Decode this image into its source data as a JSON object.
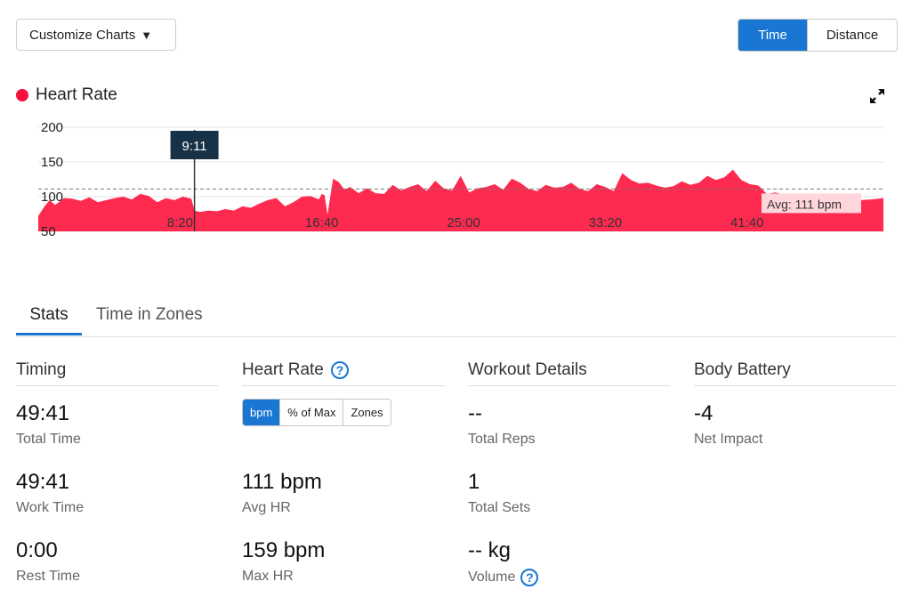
{
  "toolbar": {
    "customize_label": "Customize Charts",
    "caret": "▼",
    "axis_toggle": [
      {
        "label": "Time",
        "active": true
      },
      {
        "label": "Distance",
        "active": false
      }
    ]
  },
  "chart_legend": {
    "label": "Heart Rate",
    "color": "#f5113c"
  },
  "icons": {
    "expand": "expand-icon",
    "help": "help-icon"
  },
  "chart_data": {
    "type": "area",
    "x_unit": "time (seconds)",
    "y_ticks": [
      "200",
      "150",
      "100",
      "50"
    ],
    "ylim": [
      50,
      200
    ],
    "xlim": [
      0,
      2981
    ],
    "x_ticks": [
      {
        "label": "8:20",
        "value": 500
      },
      {
        "label": "16:40",
        "value": 1000
      },
      {
        "label": "25:00",
        "value": 1500
      },
      {
        "label": "33:20",
        "value": 2000
      },
      {
        "label": "41:40",
        "value": 2500
      }
    ],
    "grid": true,
    "color": "#fe2a4f",
    "series": [
      {
        "x": [
          0,
          20,
          40,
          60,
          90,
          120,
          150,
          180,
          210,
          240,
          270,
          300,
          330,
          360,
          390,
          420,
          450,
          480,
          510,
          540,
          551,
          570,
          600,
          630,
          660,
          690,
          720,
          750,
          780,
          810,
          840,
          870,
          900,
          930,
          960,
          990,
          1000,
          1010,
          1020,
          1040,
          1060,
          1080,
          1100,
          1130,
          1160,
          1190,
          1220,
          1250,
          1280,
          1310,
          1340,
          1370,
          1400,
          1430,
          1460,
          1490,
          1520,
          1550,
          1580,
          1610,
          1640,
          1670,
          1700,
          1730,
          1760,
          1790,
          1820,
          1850,
          1880,
          1910,
          1940,
          1970,
          2000,
          2030,
          2060,
          2090,
          2120,
          2150,
          2180,
          2210,
          2240,
          2270,
          2300,
          2330,
          2360,
          2390,
          2420,
          2450,
          2480,
          2510,
          2540,
          2570,
          2600,
          2630,
          2660,
          2700,
          2740,
          2780,
          2820,
          2860,
          2900,
          2940,
          2981
        ],
        "values": [
          72,
          85,
          95,
          88,
          98,
          97,
          94,
          99,
          92,
          95,
          98,
          100,
          96,
          104,
          101,
          92,
          98,
          95,
          100,
          97,
          80,
          78,
          80,
          79,
          82,
          80,
          86,
          84,
          90,
          95,
          98,
          86,
          92,
          100,
          101,
          96,
          104,
          102,
          74,
          126,
          121,
          110,
          114,
          105,
          112,
          105,
          104,
          117,
          109,
          114,
          118,
          108,
          123,
          112,
          109,
          130,
          106,
          112,
          114,
          118,
          110,
          126,
          120,
          111,
          108,
          117,
          113,
          114,
          120,
          111,
          108,
          118,
          114,
          108,
          134,
          124,
          119,
          120,
          116,
          113,
          115,
          122,
          117,
          120,
          130,
          124,
          128,
          139,
          124,
          118,
          116,
          104,
          106,
          103,
          102,
          100,
          103,
          99,
          96,
          97,
          95,
          96,
          98
        ]
      }
    ],
    "average": {
      "value": 111,
      "label": "Avg: 111 bpm"
    },
    "cursor": {
      "x": 551,
      "label": "9:11"
    }
  },
  "tabs": [
    {
      "label": "Stats",
      "active": true
    },
    {
      "label": "Time in Zones",
      "active": false
    }
  ],
  "columns": {
    "timing": {
      "title": "Timing",
      "stats": [
        {
          "value": "49:41",
          "label": "Total Time"
        },
        {
          "value": "49:41",
          "label": "Work Time"
        },
        {
          "value": "0:00",
          "label": "Rest Time"
        }
      ]
    },
    "heart_rate": {
      "title": "Heart Rate",
      "help": "?",
      "units": [
        {
          "label": "bpm",
          "active": true
        },
        {
          "label": "% of Max",
          "active": false
        },
        {
          "label": "Zones",
          "active": false
        }
      ],
      "stats": [
        {
          "value": "111 bpm",
          "label": "Avg HR"
        },
        {
          "value": "159 bpm",
          "label": "Max HR"
        }
      ]
    },
    "workout": {
      "title": "Workout Details",
      "stats": [
        {
          "value": "--",
          "label": "Total Reps"
        },
        {
          "value": "1",
          "label": "Total Sets"
        },
        {
          "value": "-- kg",
          "label": "Volume"
        }
      ]
    },
    "body_battery": {
      "title": "Body Battery",
      "stats": [
        {
          "value": "-4",
          "label": "Net Impact"
        }
      ]
    }
  }
}
